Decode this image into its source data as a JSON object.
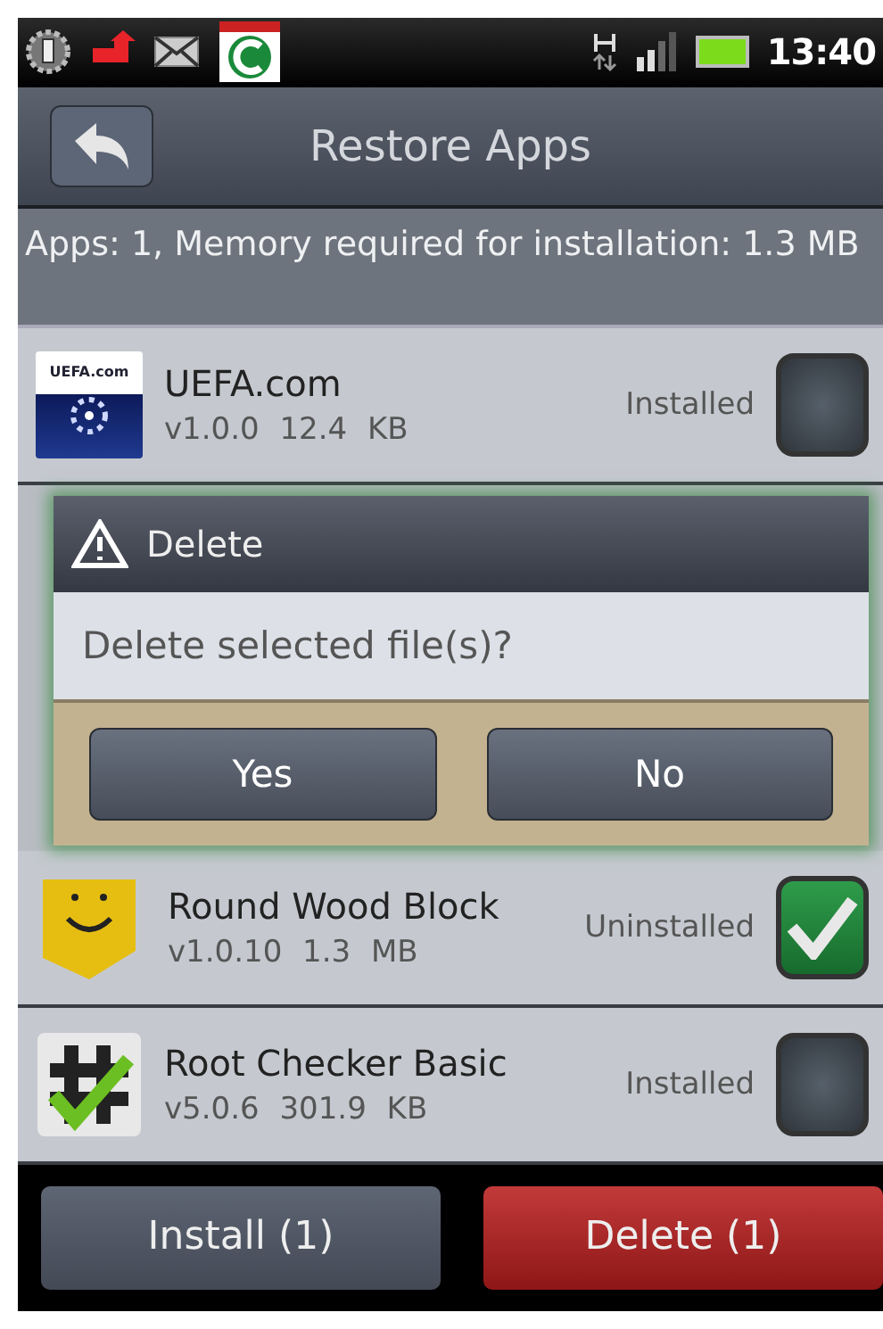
{
  "status_bar": {
    "time": "13:40"
  },
  "header": {
    "title": "Restore Apps"
  },
  "summary": "Apps: 1, Memory required for installation: 1.3 MB",
  "apps": [
    {
      "kind": "globe",
      "icon_text": "UEFA.com",
      "name": "UEFA.com",
      "version": "v1.0.0",
      "size": "12.4 KB",
      "status": "Installed",
      "checked": false
    },
    {
      "kind": "smiley",
      "name": "Round Wood Block",
      "version": "v1.0.10",
      "size": "1.3 MB",
      "status": "Uninstalled",
      "checked": true
    },
    {
      "kind": "hash",
      "name": "Root Checker Basic",
      "version": "v5.0.6",
      "size": "301.9 KB",
      "status": "Installed",
      "checked": false
    }
  ],
  "dialog": {
    "title": "Delete",
    "message": "Delete selected file(s)?",
    "buttons": [
      "Yes",
      "No"
    ]
  },
  "actions": [
    {
      "label": "Install (1)",
      "kind": "neutral"
    },
    {
      "label": "Delete (1)",
      "kind": "danger"
    }
  ]
}
